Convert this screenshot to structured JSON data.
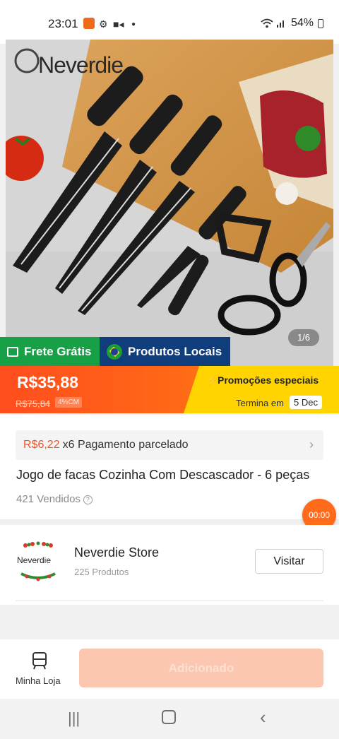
{
  "status_bar": {
    "time": "23:01",
    "battery": "54%"
  },
  "gallery": {
    "brand_logo_text": "Neverdie",
    "counter": "1/6"
  },
  "tags": {
    "free_shipping": "Frete Grátis",
    "local_products": "Produtos Locais"
  },
  "price": {
    "current": "R$35,88",
    "original": "R$75,84",
    "discount": "4%CM",
    "promo_title": "Promoções especiais",
    "ends_label": "Termina em",
    "ends_date": "5 Dec"
  },
  "installment": {
    "amount": "R$6,22",
    "text": "x6 Pagamento parcelado"
  },
  "product": {
    "title": "Jogo de facas Cozinha Com Descascador - 6 peças",
    "sold": "421 Vendidos"
  },
  "timer": "00:00",
  "store": {
    "logo_text": "Neverdie",
    "name": "Neverdie Store",
    "products": "225 Produtos",
    "visit_label": "Visitar"
  },
  "bottom_bar": {
    "my_shop_label": "Minha Loja",
    "add_button_label": "Adicionado"
  },
  "colors": {
    "accent": "#ff5a1f",
    "promo_yellow": "#ffd400",
    "free_shipping_green": "#17a046",
    "local_blue": "#103d7c"
  },
  "icons": [
    "notification-app-icon",
    "gear-icon",
    "video-icon",
    "wifi-icon",
    "signal-icon",
    "battery-icon",
    "truck-icon",
    "brazil-flag-icon",
    "lightning-icon",
    "chevron-right-icon",
    "help-circle-icon",
    "shop-icon",
    "recents-icon",
    "home-icon",
    "back-icon"
  ]
}
